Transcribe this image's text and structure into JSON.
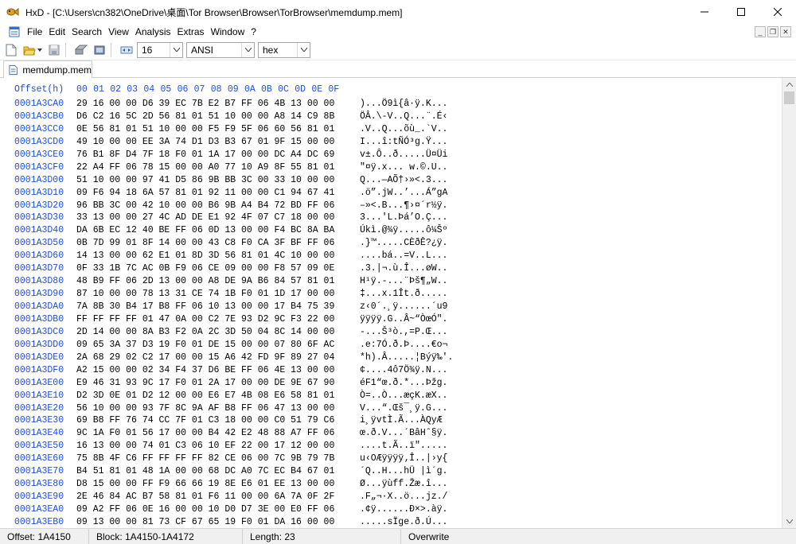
{
  "window": {
    "title": "HxD - [C:\\Users\\cn382\\OneDrive\\桌面\\Tor Browser\\Browser\\TorBrowser\\memdump.mem]"
  },
  "menu": [
    "File",
    "Edit",
    "Search",
    "View",
    "Analysis",
    "Extras",
    "Window",
    "?"
  ],
  "mdi_buttons": [
    "_",
    "❐",
    "✕"
  ],
  "toolbar": {
    "bytes_per_row": "16",
    "charset": "ANSI",
    "display_mode": "hex"
  },
  "tab": {
    "label": "memdump.mem"
  },
  "hex_view": {
    "offset_header": "Offset(h)",
    "column_headers": [
      "00",
      "01",
      "02",
      "03",
      "04",
      "05",
      "06",
      "07",
      "08",
      "09",
      "0A",
      "0B",
      "0C",
      "0D",
      "0E",
      "0F"
    ],
    "rows": [
      {
        "offset": "0001A3CA0",
        "hex": "29 16 00 00 D6 39 EC 7B E2 B7 FF 06 4B 13 00 00",
        "ascii": ")...Ö9ì{â·ÿ.K..."
      },
      {
        "offset": "0001A3CB0",
        "hex": "D6 C2 16 5C 2D 56 81 01 51 10 00 00 A8 14 C9 8B",
        "ascii": "ÖÂ.\\-V..Q...¨.É‹"
      },
      {
        "offset": "0001A3CC0",
        "hex": "0E 56 81 01 51 10 00 00 F5 F9 5F 06 60 56 81 01",
        "ascii": ".V..Q...õù_.`V.."
      },
      {
        "offset": "0001A3CD0",
        "hex": "49 10 00 00 EE 3A 74 D1 D3 B3 67 01 9F 15 00 00",
        "ascii": "I...î:tÑÓ³g.Ÿ..."
      },
      {
        "offset": "0001A3CE0",
        "hex": "76 B1 8F D4 7F 18 F0 01 1A 17 00 00 DC A4 DC 69",
        "ascii": "v±.Ô..ð.....Ü¤Üi"
      },
      {
        "offset": "0001A3CF0",
        "hex": "22 A4 FF 06 78 15 00 00 A0 77 10 A9 8F 55 81 01",
        "ascii": "\"¤ÿ.x... w.©.U.."
      },
      {
        "offset": "0001A3D00",
        "hex": "51 10 00 00 97 41 D5 86 9B BB 3C 00 33 10 00 00",
        "ascii": "Q...—AÕ†›»<.3..."
      },
      {
        "offset": "0001A3D10",
        "hex": "09 F6 94 18 6A 57 81 01 92 11 00 00 C1 94 67 41",
        "ascii": ".ö”.jW..’...Á”gA"
      },
      {
        "offset": "0001A3D20",
        "hex": "96 BB 3C 00 42 10 00 00 B6 9B A4 B4 72 BD FF 06",
        "ascii": "–»<.B...¶›¤´r½ÿ."
      },
      {
        "offset": "0001A3D30",
        "hex": "33 13 00 00 27 4C AD DE E1 92 4F 07 C7 18 00 00",
        "ascii": "3...'L.Þá’O.Ç..."
      },
      {
        "offset": "0001A3D40",
        "hex": "DA 6B EC 12 40 BE FF 06 0D 13 00 00 F4 BC 8A BA",
        "ascii": "Úkì.@¾ÿ.....ô¼Šº"
      },
      {
        "offset": "0001A3D50",
        "hex": "0B 7D 99 01 8F 14 00 00 43 C8 F0 CA 3F BF FF 06",
        "ascii": ".}™.....CÈðÊ?¿ÿ."
      },
      {
        "offset": "0001A3D60",
        "hex": "14 13 00 00 62 E1 01 8D 3D 56 81 01 4C 10 00 00",
        "ascii": "....bá..=V..L..."
      },
      {
        "offset": "0001A3D70",
        "hex": "0F 33 1B 7C AC 0B F9 06 CE 09 00 00 F8 57 09 0E",
        "ascii": ".3.|¬.ù.Î...øW.."
      },
      {
        "offset": "0001A3D80",
        "hex": "48 B9 FF 06 2D 13 00 00 A8 DE 9A B6 84 57 81 01",
        "ascii": "H¹ÿ.-...¨Þš¶„W.."
      },
      {
        "offset": "0001A3D90",
        "hex": "87 10 00 00 78 13 31 CE 74 1B F0 01 1D 17 00 00",
        "ascii": "‡...x.1Ît.ð....."
      },
      {
        "offset": "0001A3DA0",
        "hex": "7A 8B 30 B4 17 B8 FF 06 10 13 00 00 17 B4 75 39",
        "ascii": "z‹0´.¸ÿ......´u9"
      },
      {
        "offset": "0001A3DB0",
        "hex": "FF FF FF FF 01 47 0A 00 C2 7E 93 D2 9C F3 22 00",
        "ascii": "ÿÿÿÿ.G..Â~“ÒœÓ\"."
      },
      {
        "offset": "0001A3DC0",
        "hex": "2D 14 00 00 8A B3 F2 0A 2C 3D 50 04 8C 14 00 00",
        "ascii": "-...Š³ò.,=P.Œ..."
      },
      {
        "offset": "0001A3DD0",
        "hex": "09 65 3A 37 D3 19 F0 01 DE 15 00 00 07 80 6F AC",
        "ascii": ".e:7Ó.ð.Þ....€o¬"
      },
      {
        "offset": "0001A3DE0",
        "hex": "2A 68 29 02 C2 17 00 00 15 A6 42 FD 9F 89 27 04",
        "ascii": "*h).Â.....¦Býÿ‰'."
      },
      {
        "offset": "0001A3DF0",
        "hex": "A2 15 00 00 02 34 F4 37 D6 BE FF 06 4E 13 00 00",
        "ascii": "¢....4ô7Ö¾ÿ.N..."
      },
      {
        "offset": "0001A3E00",
        "hex": "E9 46 31 93 9C 17 F0 01 2A 17 00 00 DE 9E 67 90",
        "ascii": "éF1“œ.ð.*...Þžg."
      },
      {
        "offset": "0001A3E10",
        "hex": "D2 3D 0E 01 D2 12 00 00 E6 E7 4B 08 E6 58 81 01",
        "ascii": "Ò=..Ò...æçK.æX.."
      },
      {
        "offset": "0001A3E20",
        "hex": "56 10 00 00 93 7F 8C 9A AF B8 FF 06 47 13 00 00",
        "ascii": "V...“.Œš¯¸ÿ.G..."
      },
      {
        "offset": "0001A3E30",
        "hex": "69 B8 FF 76 74 CC 7F 01 C3 18 00 00 C0 51 79 C6",
        "ascii": "i¸ÿvtÌ.Ã...ÀQyÆ"
      },
      {
        "offset": "0001A3E40",
        "hex": "9C 1A F0 01 56 17 00 00 B4 42 E2 48 88 A7 FF 06",
        "ascii": "œ.ð.V...´BâHˆ§ÿ."
      },
      {
        "offset": "0001A3E50",
        "hex": "16 13 00 00 74 01 C3 06 10 EF 22 00 17 12 00 00",
        "ascii": "....t.Ã..ï\"....."
      },
      {
        "offset": "0001A3E60",
        "hex": "75 8B 4F C6 FF FF FF FF 82 CE 06 00 7C 9B 79 7B",
        "ascii": "u‹OÆÿÿÿÿ‚Î..|›y{"
      },
      {
        "offset": "0001A3E70",
        "hex": "B4 51 81 01 48 1A 00 00 68 DC A0 7C EC B4 67 01",
        "ascii": "´Q..H...hÜ |ì´g."
      },
      {
        "offset": "0001A3E80",
        "hex": "D8 15 00 00 FF F9 66 66 19 8E E6 01 EE 13 00 00",
        "ascii": "Ø...ÿùff.Žæ.î..."
      },
      {
        "offset": "0001A3E90",
        "hex": "2E 46 84 AC B7 58 81 01 F6 11 00 00 6A 7A 0F 2F",
        "ascii": ".F„¬·X..ö...jz./"
      },
      {
        "offset": "0001A3EA0",
        "hex": "09 A2 FF 06 0E 16 00 00 10 D0 D7 3E 00 E0 FF 06",
        "ascii": ".¢ÿ......Ð×>.àÿ."
      },
      {
        "offset": "0001A3EB0",
        "hex": "09 13 00 00 81 73 CF 67 65 19 F0 01 DA 16 00 00",
        "ascii": ".....sÏge.ð.Ú..."
      },
      {
        "offset": "0001A3EC0",
        "hex": "54 89 64 02 9F 7B CA 00 0C 11 00 00 BD 52 11 7C",
        "ascii": "T‰d.Ÿ{Ê.....½R.|"
      },
      {
        "offset": "0001A3ED0",
        "hex": "A7 8B 1C 03 AD 16 00 00 A9 D7 AF 2F 1E 56 81 01",
        "ascii": "§‹......©×¯/.V.."
      },
      {
        "offset": "0001A3EE0",
        "hex": "4B 10 00 00 4A 67 C4 E8 75 56 81 01 4B 10 00 00",
        "ascii": "K...JgÄèuV..K..."
      }
    ]
  },
  "status": {
    "offset": "Offset: 1A4150",
    "block": "Block: 1A4150-1A4172",
    "length": "Length: 23",
    "mode": "Overwrite"
  }
}
